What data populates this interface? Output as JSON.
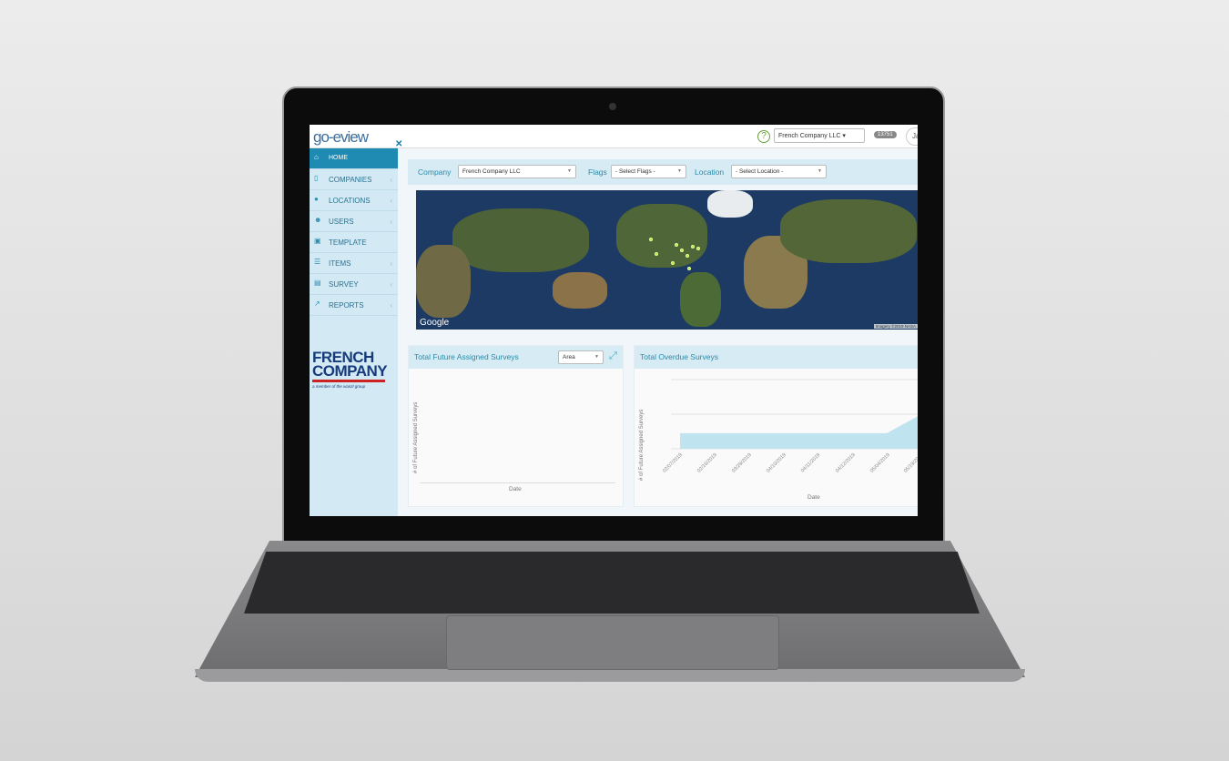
{
  "header": {
    "logo": "go-eview",
    "help_icon": "question-circle-icon",
    "company_selector": "French Company LLC",
    "badge": "13751",
    "user": "Ja"
  },
  "sidebar": {
    "items": [
      {
        "label": "HOME",
        "icon": "home-icon",
        "active": true,
        "chevron": false
      },
      {
        "label": "COMPANIES",
        "icon": "tablet-icon",
        "chevron": true
      },
      {
        "label": "LOCATIONS",
        "icon": "map-marker-icon",
        "chevron": true
      },
      {
        "label": "USERS",
        "icon": "users-icon",
        "chevron": true
      },
      {
        "label": "TEMPLATE",
        "icon": "template-icon",
        "chevron": false
      },
      {
        "label": "ITEMS",
        "icon": "list-icon",
        "chevron": true
      },
      {
        "label": "SURVEY",
        "icon": "survey-icon",
        "chevron": true
      },
      {
        "label": "REPORTS",
        "icon": "line-chart-icon",
        "chevron": true
      }
    ],
    "brand": {
      "line1": "FRENCH",
      "line2": "COMPANY",
      "tagline": "a member of the wanzl group"
    }
  },
  "filters": {
    "company_label": "Company",
    "company_value": "French Company LLC",
    "flags_label": "Flags",
    "flags_placeholder": "- Select Flags -",
    "location_label": "Location",
    "location_placeholder": "- Select Location -"
  },
  "map": {
    "provider": "Google",
    "credit": "Imagery ©2019 NASA"
  },
  "panels": {
    "future": {
      "title": "Total Future Assigned Surveys",
      "chart_type_select": "Area",
      "ylabel": "# of Future Assigned Surveys",
      "xlabel": "Date"
    },
    "overdue": {
      "title": "Total Overdue Surveys",
      "ylabel": "# of Future Assigned Surveys",
      "xlabel": "Date"
    }
  },
  "chart_data": [
    {
      "type": "area",
      "title": "Total Future Assigned Surveys",
      "xlabel": "Date",
      "ylabel": "# of Future Assigned Surveys",
      "categories": [],
      "values": []
    },
    {
      "type": "area",
      "title": "Total Overdue Surveys",
      "xlabel": "Date",
      "ylabel": "# of Future Assigned Surveys",
      "categories": [
        "02/07/2019",
        "02/16/2019",
        "03/29/2019",
        "04/10/2019",
        "04/11/2019",
        "04/12/2019",
        "05/04/2019",
        "05/19/2019"
      ],
      "values": [
        0.45,
        0.45,
        0.45,
        0.45,
        0.45,
        0.45,
        0.45,
        1.0
      ],
      "ylim": [
        0,
        2
      ],
      "grid": true,
      "color": "#bfe3ef"
    }
  ],
  "colors": {
    "accent": "#1f8ab2",
    "header_text": "#2a8aa8"
  }
}
